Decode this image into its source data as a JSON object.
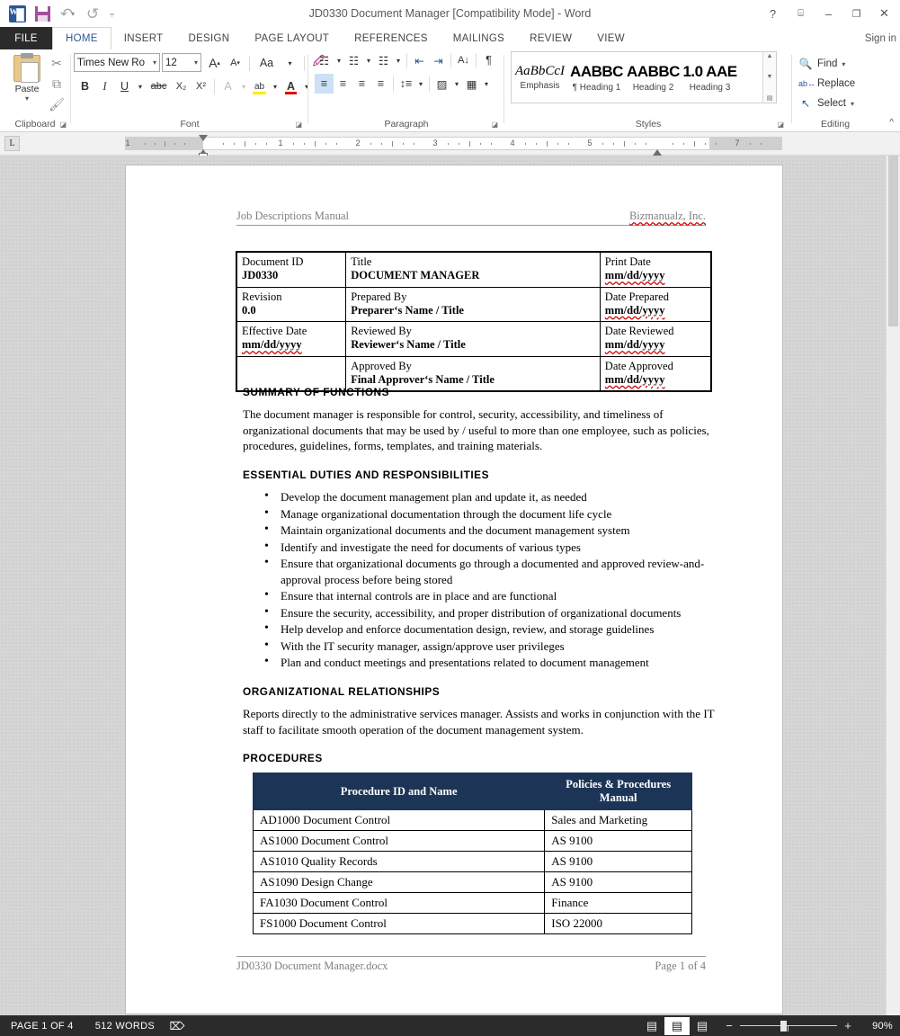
{
  "window": {
    "title": "JD0330 Document Manager [Compatibility Mode] - Word",
    "quick_access": [
      {
        "name": "word-logo-icon",
        "label": "W"
      },
      {
        "name": "save-icon",
        "label": "Save"
      },
      {
        "name": "undo-icon",
        "label": "↶"
      },
      {
        "name": "redo-icon",
        "label": "↺"
      },
      {
        "name": "customize-qat-icon",
        "label": "⩨"
      }
    ],
    "controls": {
      "help": "?",
      "ribbon_display": "⌸",
      "minimize": "–",
      "maximize": "❐",
      "close": "✕"
    },
    "signin": "Sign in"
  },
  "tabs": {
    "file": "FILE",
    "items": [
      {
        "label": "HOME",
        "active": true
      },
      {
        "label": "INSERT",
        "active": false
      },
      {
        "label": "DESIGN",
        "active": false
      },
      {
        "label": "PAGE LAYOUT",
        "active": false
      },
      {
        "label": "REFERENCES",
        "active": false
      },
      {
        "label": "MAILINGS",
        "active": false
      },
      {
        "label": "REVIEW",
        "active": false
      },
      {
        "label": "VIEW",
        "active": false
      }
    ]
  },
  "ribbon": {
    "clipboard": {
      "label": "Clipboard",
      "paste": "Paste",
      "cut_icon": "✂",
      "copy_icon": "⧉",
      "format_painter_icon": "🖌"
    },
    "font": {
      "label": "Font",
      "font_name": "Times New Ro",
      "font_size": "12",
      "grow_font": "A",
      "shrink_font": "A",
      "change_case": "Aa",
      "clear_formatting": "⌫",
      "bold": "B",
      "italic": "I",
      "underline": "U",
      "strikethrough": "abc",
      "subscript": "X₂",
      "superscript": "X²",
      "text_effects": "A",
      "highlight": "ab",
      "font_color": "A"
    },
    "paragraph": {
      "label": "Paragraph",
      "bullets": "☰",
      "numbering": "☰",
      "multilevel": "☰",
      "decrease_indent": "⇤",
      "increase_indent": "⇥",
      "sort": "↓",
      "show_marks": "¶",
      "align_left": "≡",
      "align_center": "≡",
      "align_right": "≡",
      "justify": "≡",
      "line_spacing": "↕",
      "shading": "▨",
      "borders": "▦"
    },
    "styles": {
      "label": "Styles",
      "gallery": [
        {
          "preview": "AaBbCcI",
          "name": "Emphasis",
          "kind": "em"
        },
        {
          "preview": "AABBC",
          "name": "¶ Heading 1",
          "kind": "h"
        },
        {
          "preview": "AABBC",
          "name": "Heading 2",
          "kind": "h"
        },
        {
          "preview": "1.0 AAE",
          "name": "Heading 3",
          "kind": "h"
        }
      ]
    },
    "editing": {
      "label": "Editing",
      "find": "Find",
      "replace": "Replace",
      "select": "Select"
    },
    "collapse_icon": "^"
  },
  "ruler": {
    "tab_selector": "L",
    "numbers": [
      "1",
      "1",
      "2",
      "3",
      "4",
      "5",
      "7"
    ]
  },
  "document": {
    "header": {
      "left": "Job Descriptions Manual",
      "right": "Bizmanualz, Inc."
    },
    "info_table": [
      [
        {
          "label": "Document ID",
          "value": "JD0330"
        },
        {
          "label": "Title",
          "value": "DOCUMENT MANAGER"
        },
        {
          "label": "Print Date",
          "value": "mm/dd/yyyy"
        }
      ],
      [
        {
          "label": "Revision",
          "value": "0.0"
        },
        {
          "label": "Prepared By",
          "value": "Preparer‘s Name / Title"
        },
        {
          "label": "Date Prepared",
          "value": "mm/dd/yyyy"
        }
      ],
      [
        {
          "label": "Effective Date",
          "value": "mm/dd/yyyy"
        },
        {
          "label": "Reviewed By",
          "value": "Reviewer‘s Name / Title"
        },
        {
          "label": "Date Reviewed",
          "value": "mm/dd/yyyy"
        }
      ],
      [
        {
          "label": "",
          "value": ""
        },
        {
          "label": "Approved By",
          "value": "Final Approver‘s Name / Title"
        },
        {
          "label": "Date Approved",
          "value": "mm/dd/yyyy"
        }
      ]
    ],
    "sections": {
      "summary_heading": "SUMMARY OF FUNCTIONS",
      "summary_text": "The document manager is responsible for control, security, accessibility, and timeliness of organizational documents that may be used by / useful to more than one employee, such as policies, procedures, guidelines, forms, templates, and training materials.",
      "duties_heading": "ESSENTIAL DUTIES AND RESPONSIBILITIES",
      "duties": [
        "Develop the document management plan and update it, as needed",
        "Manage organizational documentation through the document life cycle",
        "Maintain organizational documents and the document management system",
        "Identify and investigate the need for documents of various types",
        "Ensure that organizational documents go through a documented and approved review-and-approval process before being stored",
        "Ensure that internal controls are in place and are functional",
        "Ensure the security, accessibility, and proper distribution of organizational documents",
        "Help develop and enforce documentation design, review, and storage guidelines",
        "With the IT security manager, assign/approve user privileges",
        "Plan and conduct meetings and presentations related to document management"
      ],
      "relationships_heading": "ORGANIZATIONAL RELATIONSHIPS",
      "relationships_text": "Reports directly to the administrative services manager.  Assists and works in conjunction with the IT staff to facilitate smooth operation of the document management system.",
      "procedures_heading": "PROCEDURES"
    },
    "procedures_table": {
      "headers": [
        "Procedure ID and Name",
        "Policies & Procedures Manual"
      ],
      "rows": [
        [
          "AD1000 Document Control",
          "Sales and Marketing"
        ],
        [
          "AS1000 Document Control",
          "AS 9100"
        ],
        [
          "AS1010 Quality Records",
          "AS 9100"
        ],
        [
          "AS1090 Design Change",
          "AS 9100"
        ],
        [
          "FA1030 Document Control",
          "Finance"
        ],
        [
          "FS1000 Document Control",
          "ISO 22000"
        ]
      ]
    },
    "footer": {
      "left": "JD0330 Document Manager.docx",
      "right": "Page 1 of 4"
    }
  },
  "statusbar": {
    "page": "PAGE 1 OF 4",
    "words": "512 WORDS",
    "proofing_icon": "⌦",
    "views": [
      {
        "name": "read-mode-icon",
        "glyph": "▤",
        "active": false
      },
      {
        "name": "print-layout-icon",
        "glyph": "▤",
        "active": true
      },
      {
        "name": "web-layout-icon",
        "glyph": "▤",
        "active": false
      }
    ],
    "zoom_out": "−",
    "zoom_in": "+",
    "zoom_level": "90%"
  },
  "colors": {
    "accent": "#2b579a",
    "table_header": "#1c3557",
    "statusbar_bg": "#2b2b2b"
  }
}
